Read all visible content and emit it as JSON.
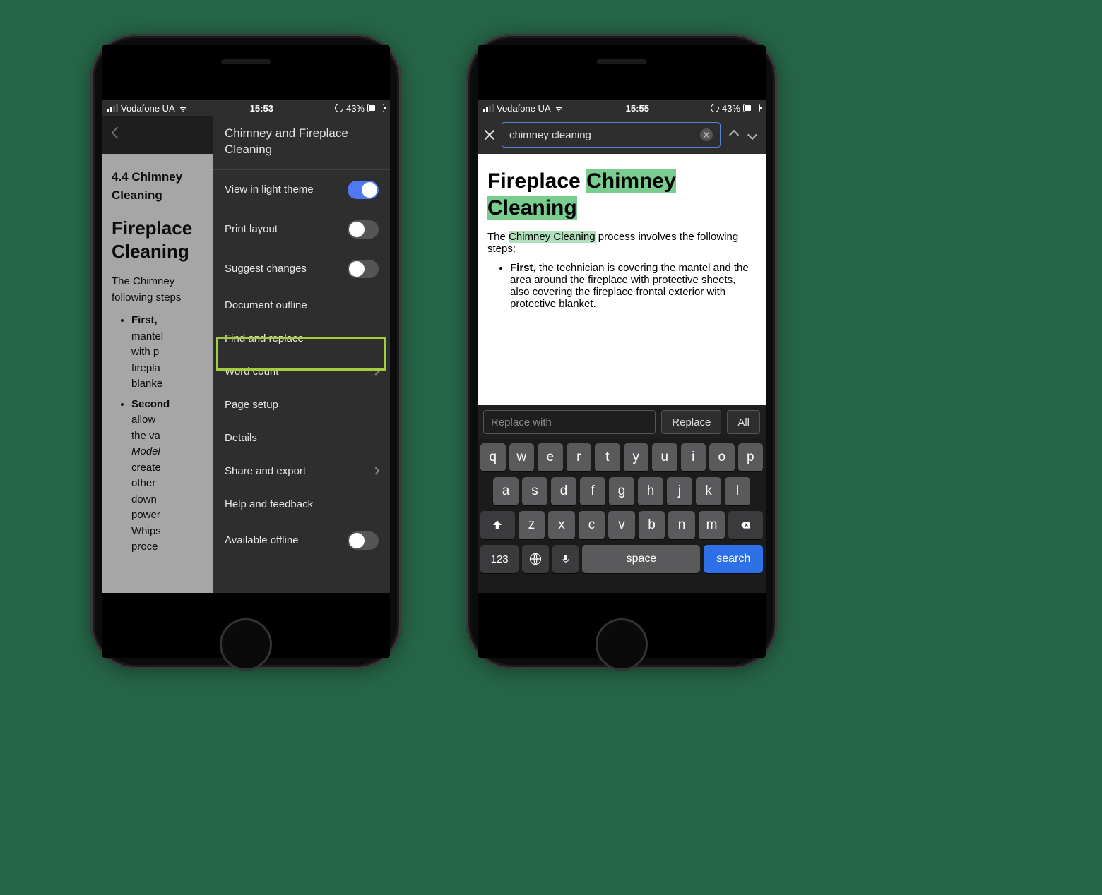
{
  "status": {
    "carrier": "Vodafone UA",
    "time_left": "15:53",
    "time_right": "15:55",
    "battery_pct": "43%"
  },
  "left": {
    "doc": {
      "section_num": "4.4 Chimney",
      "section_sub": "Cleaning",
      "title_l1": "Fireplace",
      "title_l2": "Cleaning",
      "intro": "The Chimney",
      "intro2": "following steps",
      "li1_lead": "First,",
      "li1_rest": "mantel with p fireplace blanket",
      "li2_lead": "Second",
      "li2_rest": "allow the va Model create other down power Whips proce"
    },
    "drawer": {
      "title": "Chimney and Fireplace Cleaning",
      "items": {
        "light_theme": "View in light theme",
        "print_layout": "Print layout",
        "suggest": "Suggest changes",
        "outline": "Document outline",
        "find_replace": "Find and replace",
        "word_count": "Word count",
        "page_setup": "Page setup",
        "details": "Details",
        "share": "Share and export",
        "help": "Help and feedback",
        "offline": "Available offline"
      }
    }
  },
  "right": {
    "search": {
      "value": "chimney cleaning"
    },
    "doc": {
      "h_pre": "Fireplace ",
      "h_hl1": "Chimney",
      "h_hl2": "Cleaning",
      "p_lead": "The ",
      "p_hl": "Chimney Cleaning",
      "p_rest": " process involves the following steps:",
      "li_lead": "First,",
      "li_rest": " the technician is covering the mantel and the area around the fireplace with protective sheets, also covering the fireplace frontal exterior with protective blanket."
    },
    "replace": {
      "placeholder": "Replace with",
      "replace_btn": "Replace",
      "all_btn": "All"
    },
    "keyboard": {
      "r1": [
        "q",
        "w",
        "e",
        "r",
        "t",
        "y",
        "u",
        "i",
        "o",
        "p"
      ],
      "r2": [
        "a",
        "s",
        "d",
        "f",
        "g",
        "h",
        "j",
        "k",
        "l"
      ],
      "r3": [
        "z",
        "x",
        "c",
        "v",
        "b",
        "n",
        "m"
      ],
      "num": "123",
      "space": "space",
      "search": "search"
    }
  }
}
